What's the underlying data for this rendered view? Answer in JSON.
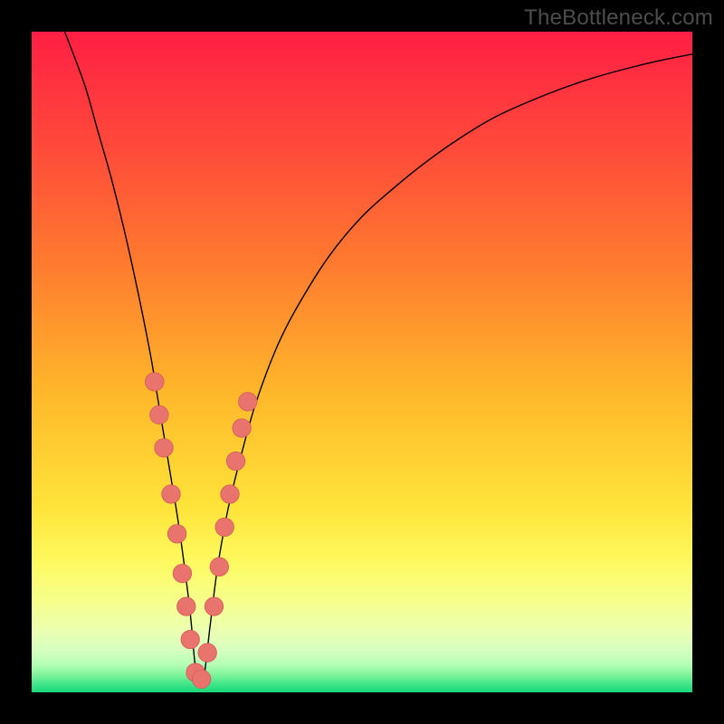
{
  "watermark": "TheBottleneck.com",
  "colors": {
    "frame": "#000000",
    "curve": "#000000",
    "marker_fill": "#e9746e",
    "marker_stroke": "#d45f5a",
    "gradient_stops": [
      {
        "offset": 0.0,
        "color": "#ff1f44"
      },
      {
        "offset": 0.18,
        "color": "#ff4b3a"
      },
      {
        "offset": 0.35,
        "color": "#ff7a2f"
      },
      {
        "offset": 0.55,
        "color": "#ffb82a"
      },
      {
        "offset": 0.72,
        "color": "#ffe43a"
      },
      {
        "offset": 0.8,
        "color": "#fff95e"
      },
      {
        "offset": 0.86,
        "color": "#f6ff8a"
      },
      {
        "offset": 0.905,
        "color": "#ecffb0"
      },
      {
        "offset": 0.935,
        "color": "#d8ffc0"
      },
      {
        "offset": 0.958,
        "color": "#b6ffb6"
      },
      {
        "offset": 0.975,
        "color": "#7af29a"
      },
      {
        "offset": 0.988,
        "color": "#3fe58a"
      },
      {
        "offset": 1.0,
        "color": "#17d877"
      }
    ]
  },
  "chart_data": {
    "type": "line",
    "title": "",
    "xlabel": "",
    "ylabel": "",
    "xlim": [
      0,
      100
    ],
    "ylim": [
      0,
      100
    ],
    "note": "Values are read in image-space percentages of the inner plot area; x is left→right 0–100, y is the curve height where 0 = bottom edge (green) and 100 = top edge (red). The curve is a V-shaped bottleneck profile touching 0 near x≈25.",
    "series": [
      {
        "name": "bottleneck-curve",
        "x": [
          5,
          8,
          10,
          12,
          14,
          16,
          18,
          19,
          20,
          21,
          22,
          23,
          24,
          25,
          26,
          27,
          28,
          29,
          30,
          32,
          34,
          37,
          40,
          45,
          50,
          55,
          60,
          65,
          70,
          75,
          80,
          85,
          90,
          95,
          100
        ],
        "y": [
          100,
          92,
          85,
          78,
          70,
          61,
          51,
          45,
          39,
          33,
          27,
          20,
          12,
          2,
          2,
          10,
          18,
          24,
          29,
          37,
          44,
          52,
          58,
          66,
          72,
          76.5,
          80.5,
          84,
          87,
          89.3,
          91.3,
          93,
          94.4,
          95.6,
          96.6
        ]
      }
    ],
    "markers": {
      "name": "highlighted-points",
      "note": "Pink rounded markers clustered near the valley on both branches.",
      "points": [
        {
          "x": 18.6,
          "y": 47
        },
        {
          "x": 19.3,
          "y": 42
        },
        {
          "x": 20.0,
          "y": 37
        },
        {
          "x": 21.1,
          "y": 30
        },
        {
          "x": 22.0,
          "y": 24
        },
        {
          "x": 22.8,
          "y": 18
        },
        {
          "x": 23.4,
          "y": 13
        },
        {
          "x": 24.0,
          "y": 8
        },
        {
          "x": 24.8,
          "y": 3
        },
        {
          "x": 25.7,
          "y": 2
        },
        {
          "x": 26.6,
          "y": 6
        },
        {
          "x": 27.6,
          "y": 13
        },
        {
          "x": 28.4,
          "y": 19
        },
        {
          "x": 29.2,
          "y": 25
        },
        {
          "x": 30.0,
          "y": 30
        },
        {
          "x": 30.9,
          "y": 35
        },
        {
          "x": 31.8,
          "y": 40
        },
        {
          "x": 32.7,
          "y": 44
        }
      ],
      "radius_pct": 1.4
    }
  }
}
